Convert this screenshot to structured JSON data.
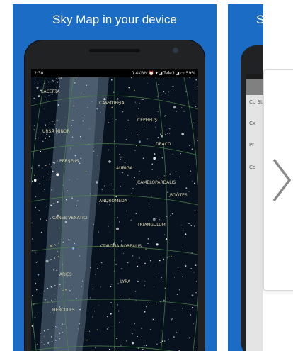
{
  "screenshot_1": {
    "caption": "Sky Map in your device",
    "status_time": "2:30",
    "status_right": "0.4KB/s ⏰ ▾ ◢ Tele3 ◢ ▭ 59%",
    "constellation_labels": [
      "LACERTA",
      "CASSIOPEIA",
      "CEPHEUS",
      "URSA MINOR",
      "DRACO",
      "PERSEUS",
      "AURIGA",
      "CAMELOPARDALIS",
      "ANDROMEDA",
      "BOÖTES",
      "CANES VENATICI",
      "TRIANGULUM",
      "CORONA BOREALIS",
      "ARIES",
      "LYRA",
      "HERCULES"
    ]
  },
  "screenshot_2": {
    "caption": "S",
    "rows": [
      "Cu\nSt",
      "Cx",
      "Pr",
      "Cc"
    ]
  },
  "navigation": {
    "next_icon": "chevron-right-icon"
  },
  "colors": {
    "card_background": "#1a6cc4",
    "sky": "#08121e",
    "grid": "#4f8a49",
    "milky_way": "#7b93a8"
  }
}
